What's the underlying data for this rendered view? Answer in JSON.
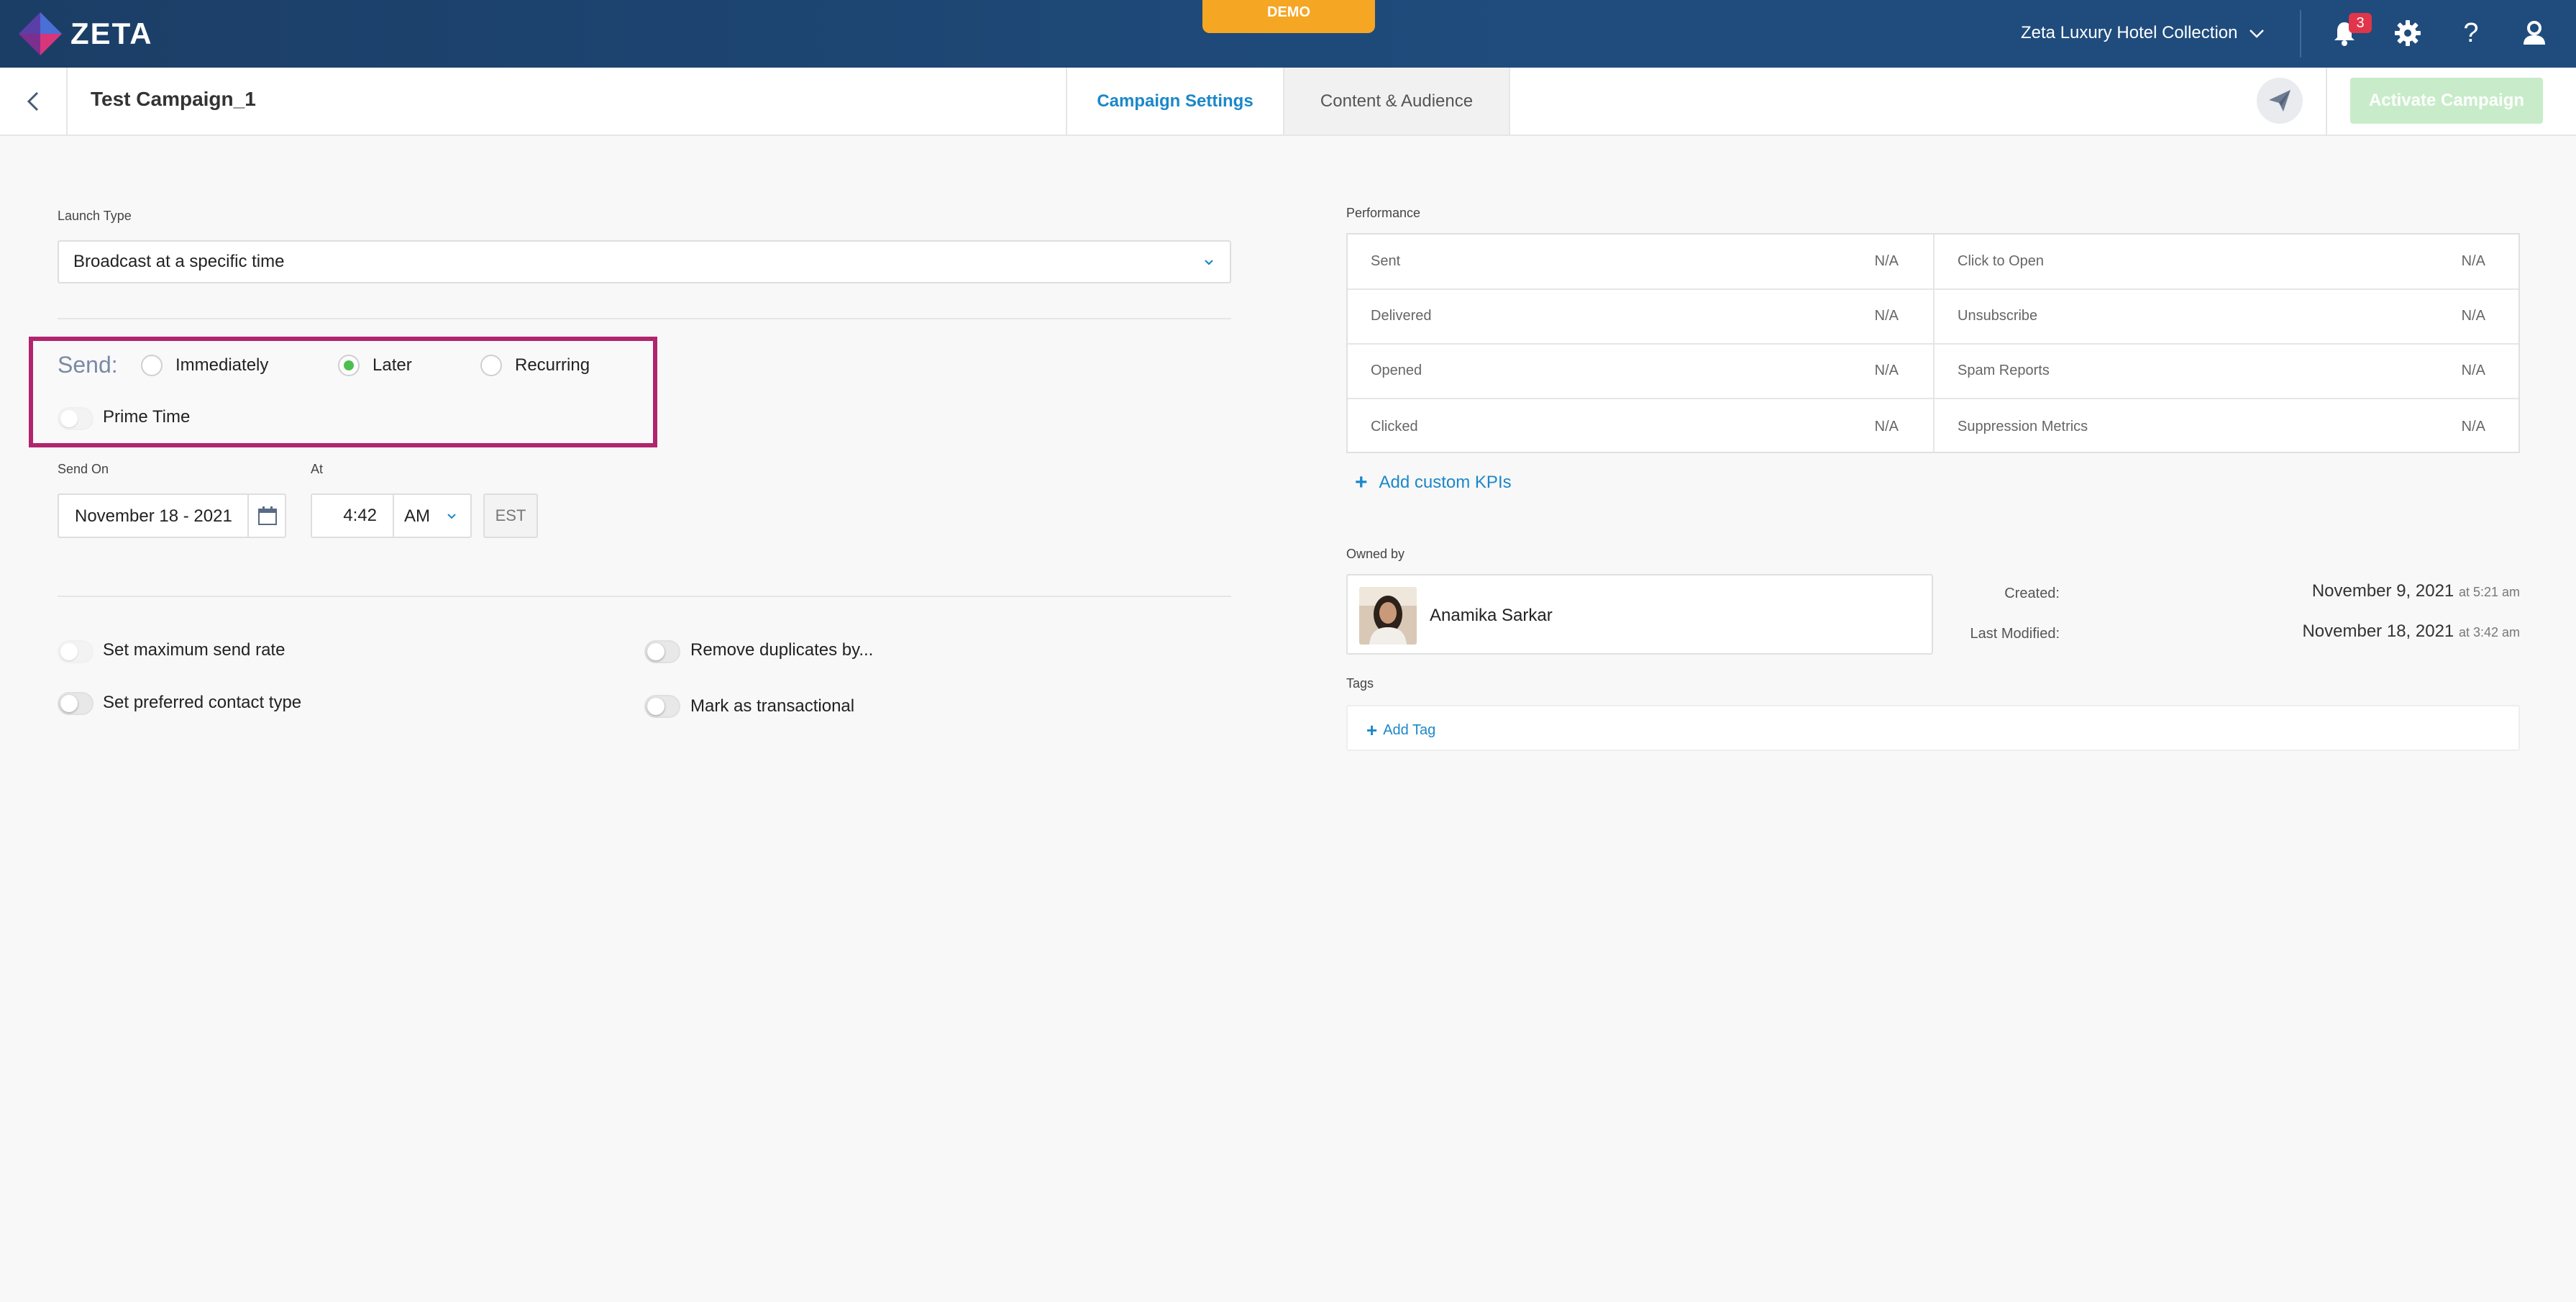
{
  "app": {
    "logo_text": "ZETA",
    "demo_badge": "DEMO",
    "account_name": "Zeta Luxury Hotel Collection",
    "notification_count": "3"
  },
  "subheader": {
    "campaign_title": "Test Campaign_1",
    "tabs": [
      {
        "label": "Campaign Settings",
        "active": true
      },
      {
        "label": "Content & Audience",
        "active": false
      }
    ],
    "activate_label": "Activate Campaign"
  },
  "launch": {
    "label": "Launch Type",
    "value": "Broadcast at a specific time"
  },
  "send": {
    "label": "Send:",
    "options": [
      {
        "label": "Immediately",
        "selected": false
      },
      {
        "label": "Later",
        "selected": true
      },
      {
        "label": "Recurring",
        "selected": false
      }
    ],
    "prime_time_label": "Prime Time"
  },
  "schedule": {
    "send_on_label": "Send On",
    "date_value": "November 18 - 2021",
    "at_label": "At",
    "time_value": "4:42",
    "ampm_value": "AM",
    "timezone": "EST"
  },
  "options": {
    "max_send_rate": "Set maximum send rate",
    "preferred_contact": "Set preferred contact type",
    "remove_duplicates": "Remove duplicates by...",
    "mark_transactional": "Mark as transactional"
  },
  "performance": {
    "label": "Performance",
    "left": [
      {
        "name": "Sent",
        "value": "N/A"
      },
      {
        "name": "Delivered",
        "value": "N/A"
      },
      {
        "name": "Opened",
        "value": "N/A"
      },
      {
        "name": "Clicked",
        "value": "N/A"
      }
    ],
    "right": [
      {
        "name": "Click to Open",
        "value": "N/A"
      },
      {
        "name": "Unsubscribe",
        "value": "N/A"
      },
      {
        "name": "Spam Reports",
        "value": "N/A"
      },
      {
        "name": "Suppression Metrics",
        "value": "N/A"
      }
    ],
    "add_kpi_label": "Add custom KPIs"
  },
  "ownership": {
    "label": "Owned by",
    "owner_name": "Anamika Sarkar",
    "created_label": "Created:",
    "created_date": "November 9, 2021",
    "created_time": "at 5:21 am",
    "modified_label": "Last Modified:",
    "modified_date": "November 18, 2021",
    "modified_time": "at 3:42 am"
  },
  "tags": {
    "label": "Tags",
    "add_label": "Add Tag"
  },
  "colors": {
    "topbar": "#1f4c7d",
    "demo": "#f5a623",
    "accent": "#1b87c9",
    "selected_radio": "#4cc04f",
    "highlight": "#b1246e",
    "activate_disabled": "#c8ecc9"
  }
}
